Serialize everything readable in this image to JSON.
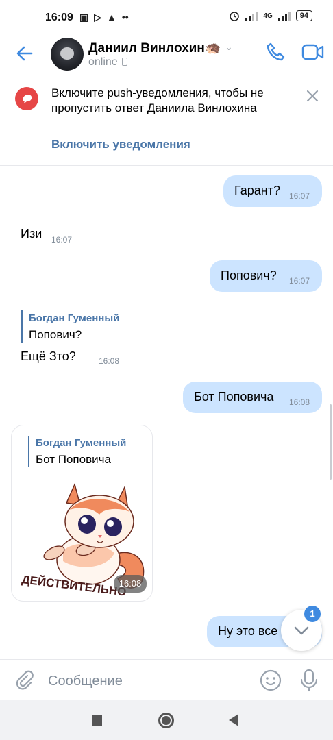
{
  "status_bar": {
    "time": "16:09",
    "left_icons": [
      "sim-icon",
      "play-icon",
      "warning-icon",
      "more-dots-icon"
    ],
    "network": "4G",
    "battery": "94"
  },
  "header": {
    "contact_name": "Даниил Винлохин",
    "name_emoji": "🦔",
    "status": "online"
  },
  "notice": {
    "text": "Включите push-уведомления, чтобы не пропустить ответ Даниила Винлохина",
    "action": "Включить уведомления"
  },
  "messages": {
    "m1": {
      "text": "Гарант?",
      "time": "16:07"
    },
    "m2": {
      "text": "Изи",
      "time": "16:07"
    },
    "m3": {
      "text": "Попович?",
      "time": "16:07"
    },
    "m4": {
      "reply_author": "Богдан Гуменный",
      "reply_text": "Попович?",
      "text": "Ещё Зто?",
      "time": "16:08"
    },
    "m5": {
      "text": "Бот Поповича",
      "time": "16:08"
    },
    "m6": {
      "reply_author": "Богдан Гуменный",
      "reply_text": "Бот Поповича",
      "sticker_caption": "ДЕЙСТВИТЕЛЬНО",
      "time": "16:08"
    },
    "m7": {
      "text": "Ну это все"
    }
  },
  "scroll_down": {
    "badge": "1"
  },
  "composer": {
    "placeholder": "Сообщение"
  },
  "colors": {
    "accent": "#4a76a8",
    "outgoing_bubble": "#cce4ff",
    "notice_icon": "#e64646",
    "badge": "#3f8ae0"
  }
}
